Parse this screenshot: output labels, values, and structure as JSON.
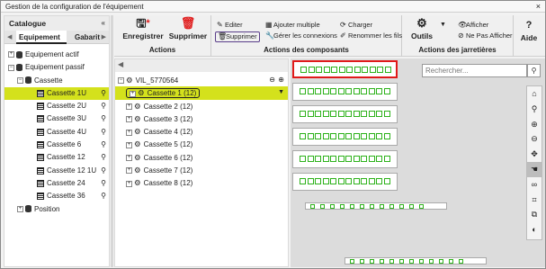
{
  "window": {
    "title": "Gestion de la configuration de l'équipement",
    "close": "×"
  },
  "catalogue": {
    "title": "Catalogue",
    "collapse": "«",
    "tabs": [
      "Equipement",
      "Gabarit"
    ],
    "items": [
      {
        "label": "Equipement actif",
        "exp": "+",
        "level": 0
      },
      {
        "label": "Equipement passif",
        "exp": "−",
        "level": 0
      },
      {
        "label": "Cassette",
        "exp": "−",
        "level": 1
      },
      {
        "label": "Cassette 1U",
        "level": 2,
        "selected": true
      },
      {
        "label": "Cassette 2U",
        "level": 2
      },
      {
        "label": "Cassette 3U",
        "level": 2
      },
      {
        "label": "Cassette 4U",
        "level": 2
      },
      {
        "label": "Cassette 6",
        "level": 2
      },
      {
        "label": "Cassette 12",
        "level": 2
      },
      {
        "label": "Cassette 12 1U",
        "level": 2
      },
      {
        "label": "Cassette 24",
        "level": 2
      },
      {
        "label": "Cassette 36",
        "level": 2
      },
      {
        "label": "Position",
        "exp": "+",
        "level": 1
      }
    ]
  },
  "ribbon": {
    "actions": {
      "group_label": "Actions",
      "save": "Enregistrer",
      "delete": "Supprimer"
    },
    "components": {
      "group_label": "Actions des composants",
      "edit": "Editer",
      "delete": "Supprimer",
      "add_multiple": "Ajouter multiple",
      "manage_connections": "Gérer les connexions",
      "load": "Charger",
      "rename_wires": "Renommer les fils"
    },
    "jumpers": {
      "group_label": "Actions des jarretières",
      "tools": "Outils",
      "show": "Afficher",
      "hide": "Ne Pas Afficher"
    },
    "help": {
      "label": "Aide"
    }
  },
  "midtree": {
    "root": "VIL_5770564",
    "cassettes": [
      "Cassette 1 (12)",
      "Cassette 2 (12)",
      "Cassette 3 (12)",
      "Cassette 4 (12)",
      "Cassette 5 (12)",
      "Cassette 6 (12)",
      "Cassette 7 (12)",
      "Cassette 8 (12)"
    ]
  },
  "canvas": {
    "search_placeholder": "Rechercher...",
    "ports_per_panel": 12,
    "ports_per_strip": 12,
    "accent_port": "#2db21a",
    "selected_outline": "#e01a1a",
    "highlight": "#d4e11c",
    "toolbar_icons": [
      "home-icon",
      "zoom-icon",
      "zoom-in-icon",
      "zoom-out-icon",
      "move-icon",
      "pan-hand-icon",
      "link-icon",
      "crop-icon",
      "copy-icon",
      "toggle-icon"
    ]
  }
}
